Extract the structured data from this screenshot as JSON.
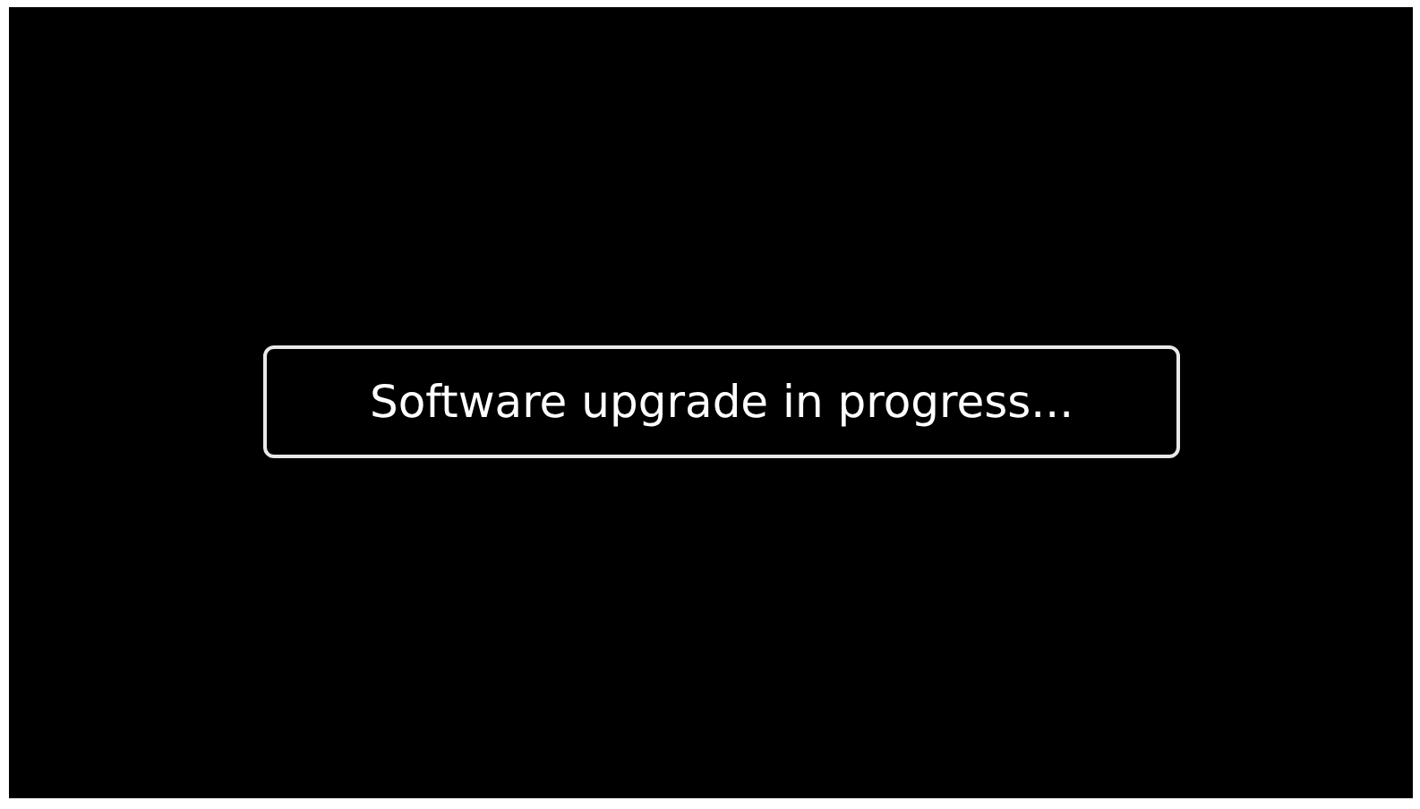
{
  "message": {
    "text": "Software upgrade in progress..."
  }
}
